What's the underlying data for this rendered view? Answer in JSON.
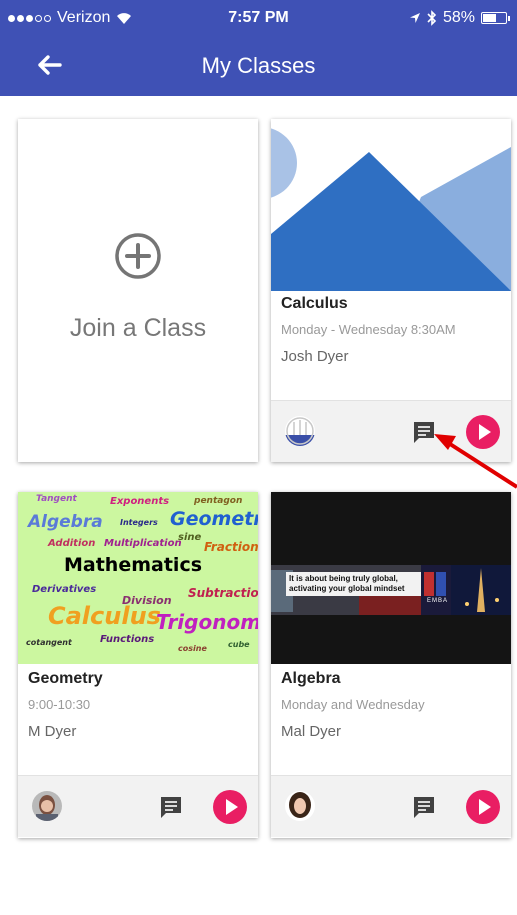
{
  "status_bar": {
    "carrier": "Verizon",
    "time": "7:57 PM",
    "battery": "58%",
    "battery_level": 0.58
  },
  "app_bar": {
    "title": "My Classes"
  },
  "join_card": {
    "label": "Join a Class"
  },
  "classes": [
    {
      "title": "Calculus",
      "schedule": "Monday - Wednesday 8:30AM",
      "teacher": "Josh Dyer"
    },
    {
      "title": "Geometry",
      "schedule": "9:00-10:30",
      "teacher": "M Dyer"
    },
    {
      "title": "Algebra",
      "schedule": "Monday and Wednesday",
      "teacher": "Mal Dyer"
    }
  ],
  "geometry_cover": {
    "center": "Mathematics",
    "words": [
      "Tangent",
      "Exponents",
      "pentagon",
      "Algebra",
      "Integers",
      "Geometry",
      "Addition",
      "Multiplication",
      "sine",
      "Fractions",
      "Derivatives",
      "Division",
      "Subtraction",
      "Calculus",
      "Trigonometry",
      "Functions",
      "cotangent",
      "cosine",
      "cube"
    ]
  },
  "algebra_cover": {
    "line1": "It is about being truly global,",
    "line2": "activating your global mindset",
    "badge": "EMBA"
  },
  "colors": {
    "primary": "#3f51b5",
    "accent": "#e91e63",
    "annotation_arrow": "#e00000"
  },
  "icons": {
    "back": "arrow-left-icon",
    "join": "plus-circle-icon",
    "message": "message-icon",
    "play": "play-icon"
  }
}
